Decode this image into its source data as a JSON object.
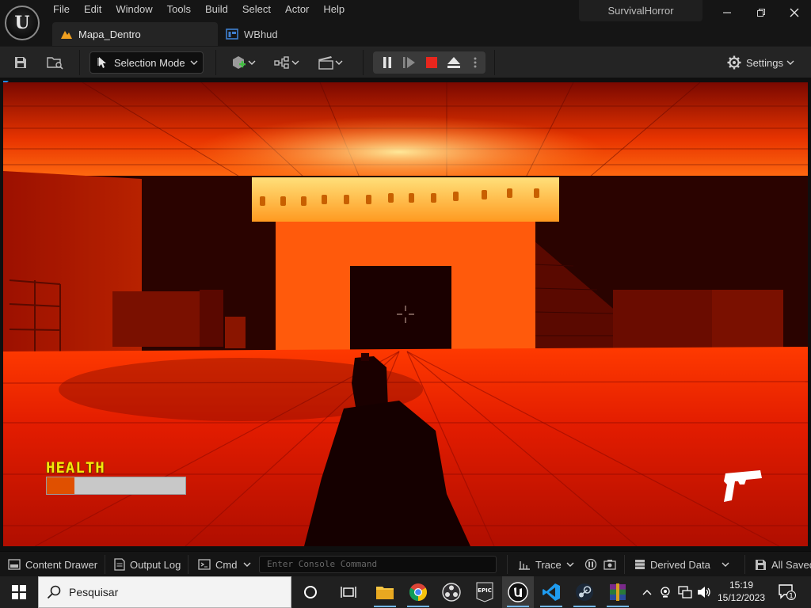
{
  "menu": [
    "File",
    "Edit",
    "Window",
    "Tools",
    "Build",
    "Select",
    "Actor",
    "Help"
  ],
  "project_name": "SurvivalHorror",
  "tabs": [
    {
      "label": "Mapa_Dentro",
      "active": true
    },
    {
      "label": "WBhud",
      "active": false
    }
  ],
  "toolbar": {
    "selection_mode": "Selection Mode",
    "settings": "Settings"
  },
  "hud": {
    "health_label": "HEALTH",
    "health_fraction": 0.2,
    "weapon_icon": "pistol-icon"
  },
  "statusbar": {
    "content_drawer": "Content Drawer",
    "output_log": "Output Log",
    "cmd": "Cmd",
    "console_placeholder": "Enter Console Command",
    "trace": "Trace",
    "derived_data": "Derived Data",
    "all_saved": "All Saved"
  },
  "taskbar": {
    "search_placeholder": "Pesquisar",
    "epic_label": "EPIC",
    "time": "15:19",
    "date": "15/12/2023",
    "notification_count": "1"
  },
  "colors": {
    "accent_blue": "#1e8cf0",
    "health_fill": "#e05000",
    "health_label": "#f2e80a",
    "stop_red": "#e8261d"
  }
}
